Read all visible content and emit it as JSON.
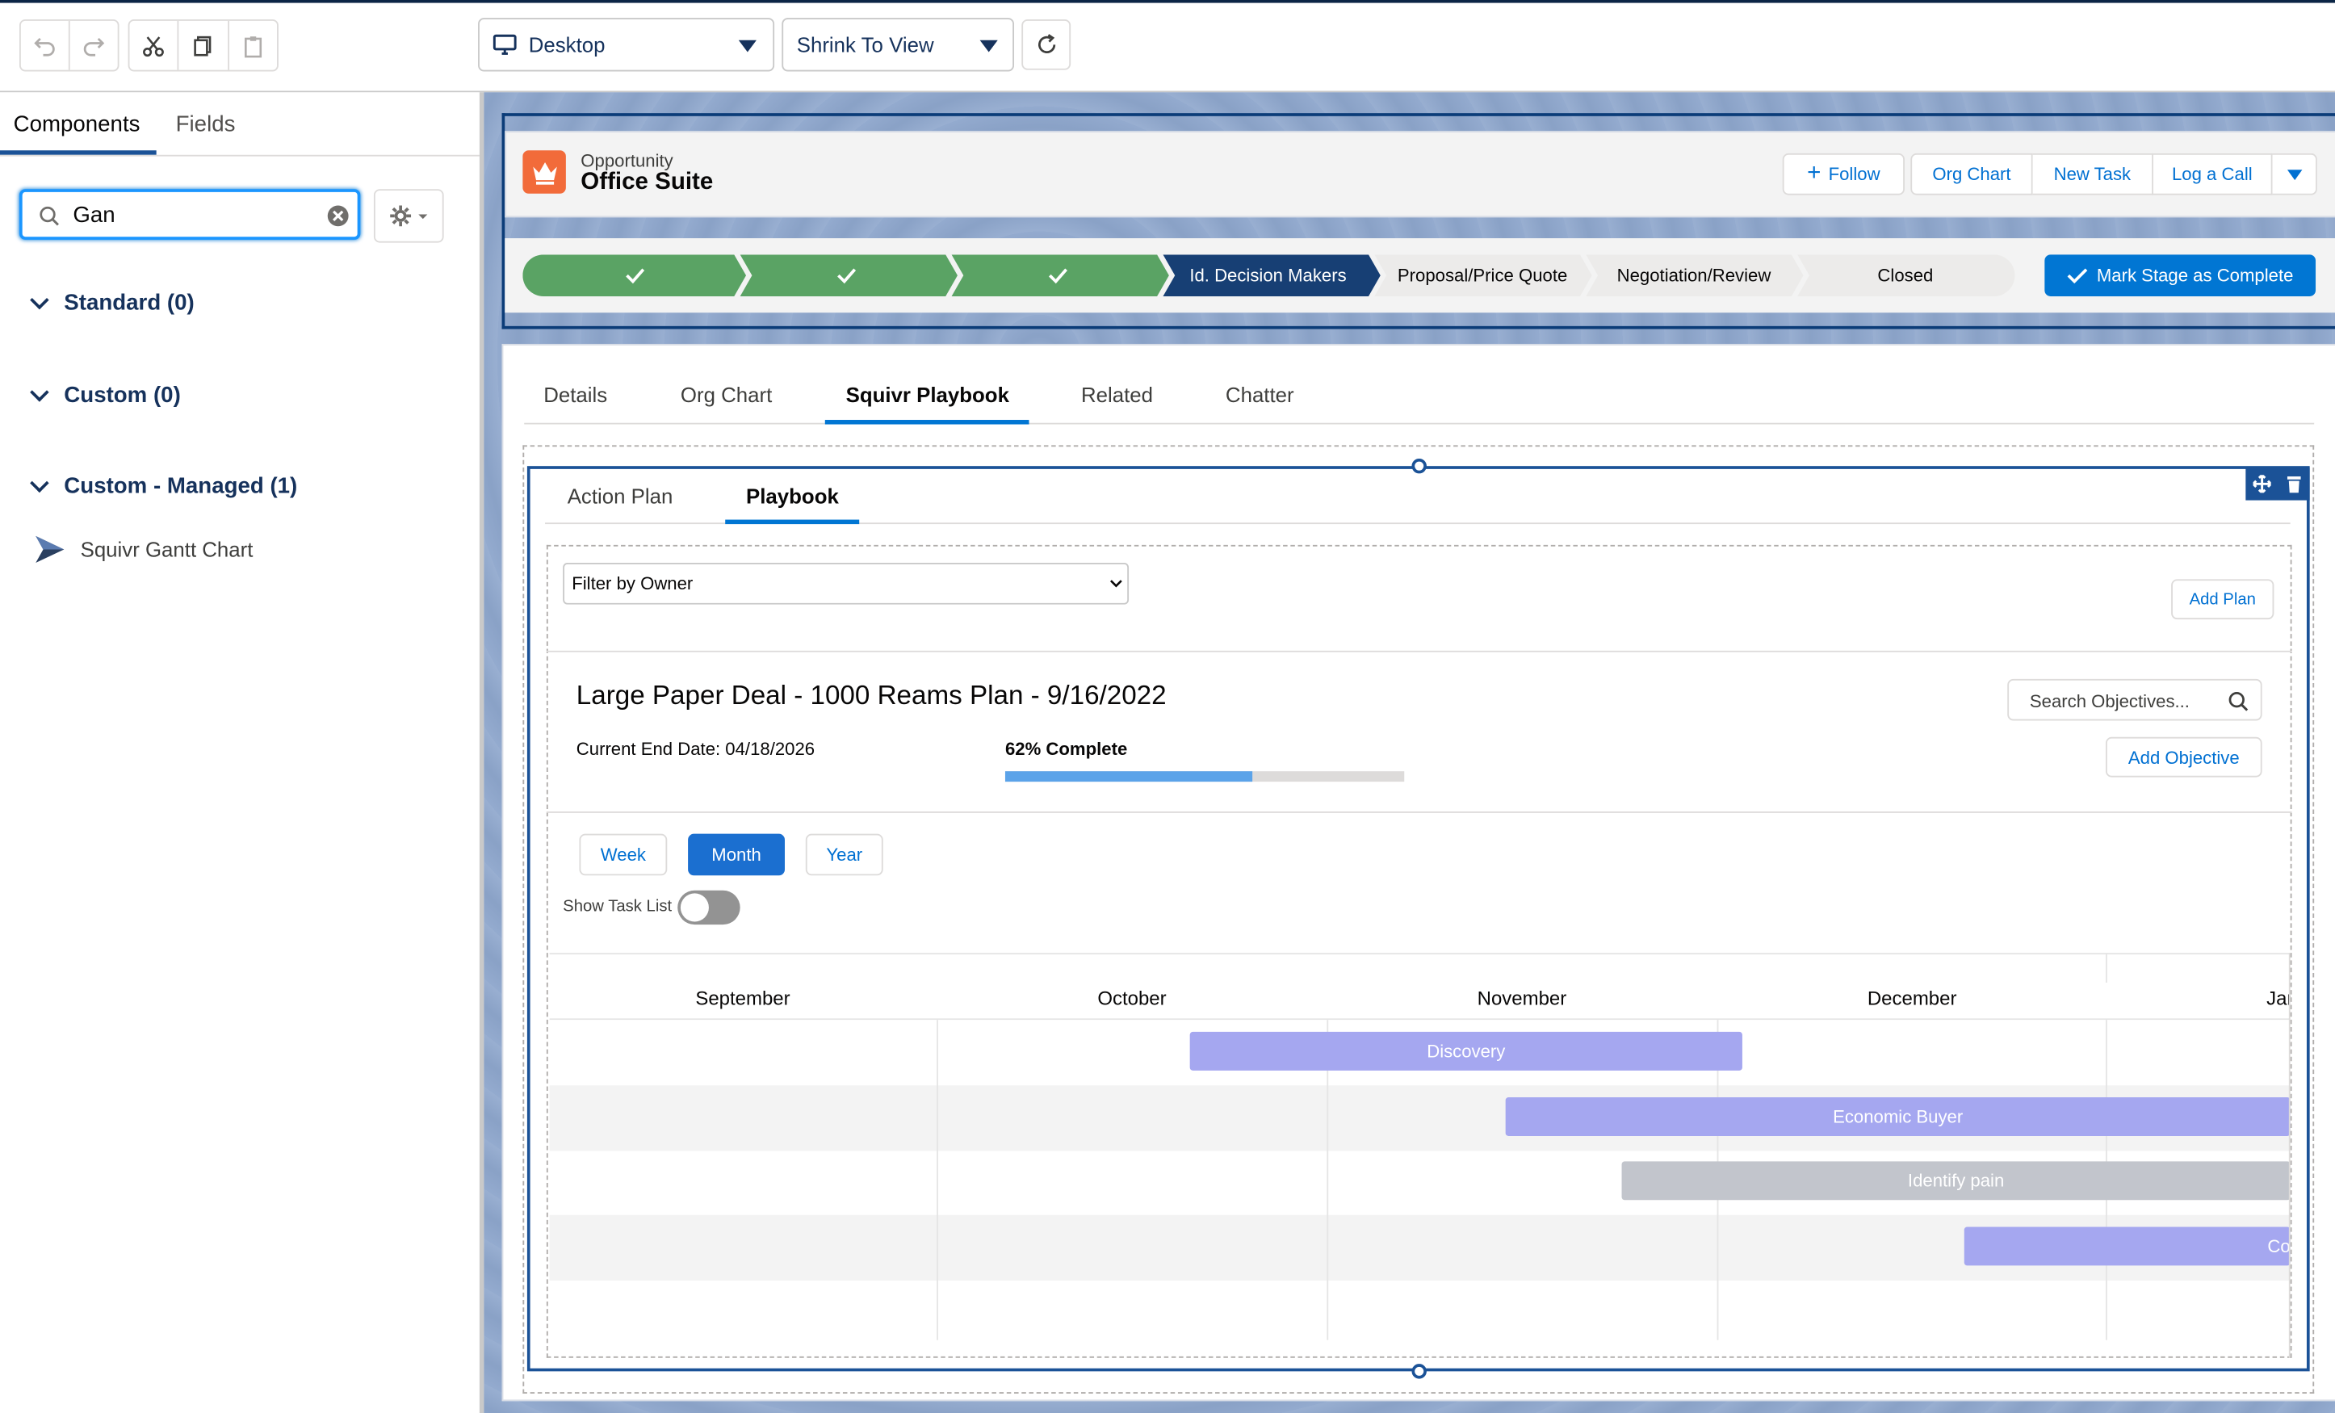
{
  "toolbar": {
    "device": "Desktop",
    "view": "Shrink To View"
  },
  "left": {
    "tabs": [
      "Components",
      "Fields"
    ],
    "search_value": "Gan",
    "sections": [
      {
        "label": "Standard (0)"
      },
      {
        "label": "Custom (0)"
      },
      {
        "label": "Custom - Managed (1)"
      }
    ],
    "component_item": "Squivr Gantt Chart"
  },
  "header": {
    "object_type": "Opportunity",
    "record_name": "Office Suite",
    "buttons": {
      "follow": "Follow",
      "org_chart": "Org Chart",
      "new_task": "New Task",
      "log_call": "Log a Call"
    },
    "brand_color": "#f26b3a"
  },
  "path": {
    "stages": [
      "Id. Decision Makers",
      "Proposal/Price Quote",
      "Negotiation/Review",
      "Closed"
    ],
    "mark_complete": "Mark Stage as Complete",
    "complete_color": "#5aa364",
    "current_color": "#173f74"
  },
  "record_tabs": [
    "Details",
    "Org Chart",
    "Squivr Playbook",
    "Related",
    "Chatter"
  ],
  "playbook": {
    "subtabs": [
      "Action Plan",
      "Playbook"
    ],
    "filter": "Filter by Owner",
    "add_plan": "Add Plan",
    "plan_title": "Large Paper Deal - 1000 Reams Plan - 9/16/2022",
    "end_date": "Current End Date: 04/18/2026",
    "percent_label": "62% Complete",
    "progress": 0.62,
    "search_placeholder": "Search Objectives...",
    "add_objective": "Add Objective",
    "ranges": {
      "week": "Week",
      "month": "Month",
      "year": "Year"
    },
    "show_task_list": "Show Task List"
  },
  "gantt": {
    "months": [
      "September",
      "October",
      "November",
      "December",
      "Jan"
    ],
    "bars": [
      {
        "name": "Discovery",
        "color": "#a5a7f0"
      },
      {
        "name": "Economic Buyer",
        "color": "#a5a7f0"
      },
      {
        "name": "Identify pain",
        "color": "#c2c5cc"
      },
      {
        "name": "Co",
        "color": "#a5a7f0"
      }
    ]
  }
}
